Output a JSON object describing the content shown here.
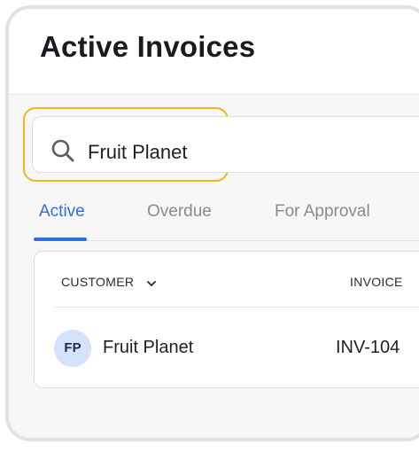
{
  "header": {
    "title": "Active Invoices"
  },
  "search": {
    "value": "Fruit Planet"
  },
  "tabs": [
    {
      "label": "Active",
      "active": true
    },
    {
      "label": "Overdue",
      "active": false
    },
    {
      "label": "For Approval",
      "active": false
    }
  ],
  "table": {
    "columns": [
      "CUSTOMER",
      "INVOICE"
    ],
    "rows": [
      {
        "initials": "FP",
        "customer": "Fruit Planet",
        "invoice": "INV-104"
      }
    ]
  },
  "colors": {
    "accent": "#2f6fe0",
    "highlight": "#f2b51d",
    "avatar_bg": "#d5e2fb"
  }
}
